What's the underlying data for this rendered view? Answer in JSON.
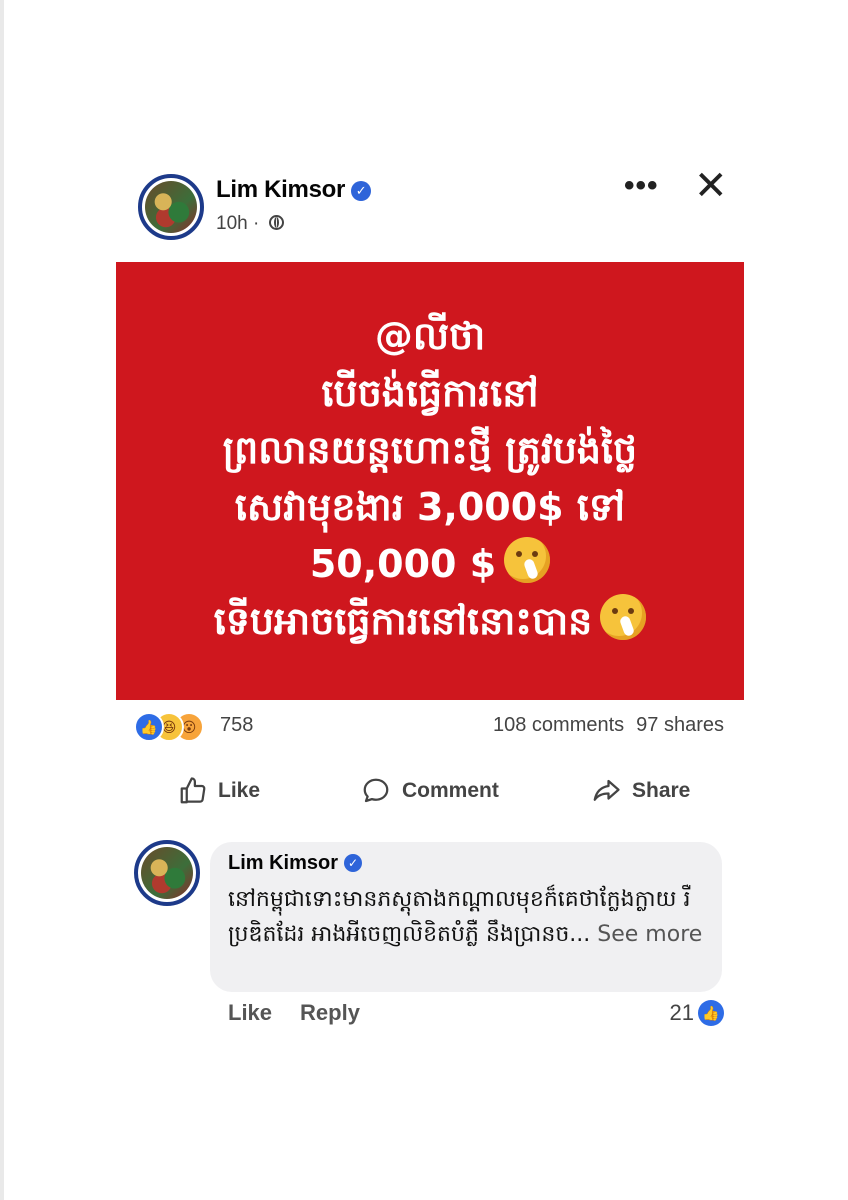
{
  "post": {
    "author": "Lim Kimsor",
    "time": "10h",
    "image_text": "@លីថា\nបើចង់ធ្វើការនៅ\nព្រលានយន្តហោះថ្មី ត្រូវបង់ថ្លៃ\nសេវាមុខងារ 3,000$ ទៅ\n50,000 $",
    "image_text_last_line": "ទើបអាចធ្វើការនៅនោះបាន"
  },
  "stats": {
    "reaction_count": "758",
    "comments": "108 comments",
    "shares": "97 shares"
  },
  "actions": {
    "like": "Like",
    "comment": "Comment",
    "share": "Share"
  },
  "comment": {
    "author": "Lim Kimsor",
    "text": "នៅកម្ពុជាទោះមានភស្តុតាងកណ្តាលមុខក៏គេថាក្លែងក្លាយ រឺប្រឌិតដែរ អាងអីចេញលិខិតបំភ្លឺ នឹងប្រានច...",
    "see_more": "See more",
    "like_label": "Like",
    "reply_label": "Reply",
    "like_count": "21"
  },
  "colors": {
    "image_background": "#cf171e",
    "facebook_blue": "#2e64d9",
    "verified_badge": "#2e64d9"
  }
}
